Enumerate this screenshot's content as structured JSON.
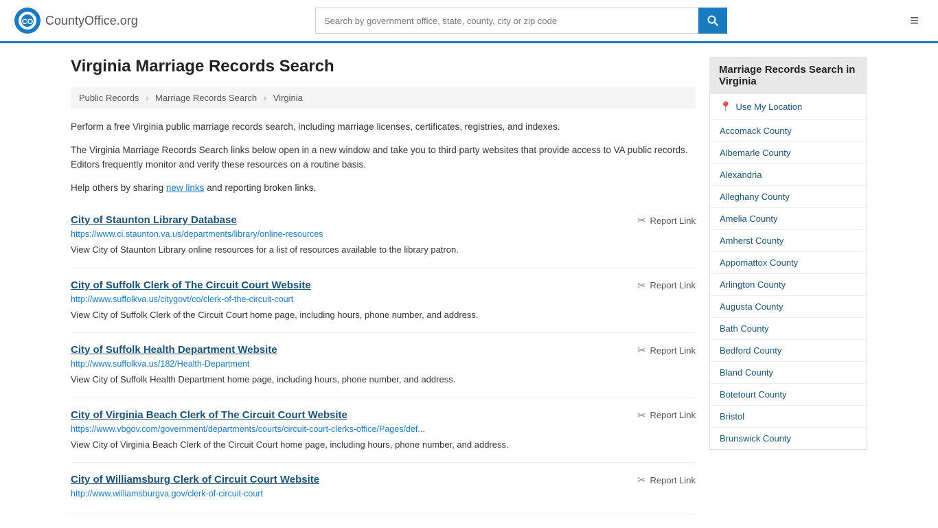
{
  "header": {
    "logo_text": "CountyOffice",
    "logo_suffix": ".org",
    "search_placeholder": "Search by government office, state, county, city or zip code",
    "menu_icon": "≡"
  },
  "page": {
    "title": "Virginia Marriage Records Search",
    "breadcrumb": {
      "items": [
        "Public Records",
        "Marriage Records Search",
        "Virginia"
      ]
    },
    "intro": [
      "Perform a free Virginia public marriage records search, including marriage licenses, certificates, registries, and indexes.",
      "The Virginia Marriage Records Search links below open in a new window and take you to third party websites that provide access to VA public records. Editors frequently monitor and verify these resources on a routine basis.",
      "Help others by sharing new links and reporting broken links."
    ],
    "results": [
      {
        "title": "City of Staunton Library Database",
        "url": "https://www.ci.staunton.va.us/departments/library/online-resources",
        "desc": "View City of Staunton Library online resources for a list of resources available to the library patron."
      },
      {
        "title": "City of Suffolk Clerk of The Circuit Court Website",
        "url": "http://www.suffolkva.us/citygovt/co/clerk-of-the-circuit-court",
        "desc": "View City of Suffolk Clerk of the Circuit Court home page, including hours, phone number, and address."
      },
      {
        "title": "City of Suffolk Health Department Website",
        "url": "http://www.suffolkva.us/182/Health-Department",
        "desc": "View City of Suffolk Health Department home page, including hours, phone number, and address."
      },
      {
        "title": "City of Virginia Beach Clerk of The Circuit Court Website",
        "url": "https://www.vbgov.com/government/departments/courts/circuit-court-clerks-office/Pages/def...",
        "desc": "View City of Virginia Beach Clerk of the Circuit Court home page, including hours, phone number, and address."
      },
      {
        "title": "City of Williamsburg Clerk of Circuit Court Website",
        "url": "http://www.williamsburgva.gov/clerk-of-circuit-court",
        "desc": ""
      }
    ],
    "report_link_label": "Report Link"
  },
  "sidebar": {
    "title": "Marriage Records Search in Virginia",
    "use_location_label": "Use My Location",
    "counties": [
      "Accomack County",
      "Albemarle County",
      "Alexandria",
      "Alleghany County",
      "Amelia County",
      "Amherst County",
      "Appomattox County",
      "Arlington County",
      "Augusta County",
      "Bath County",
      "Bedford County",
      "Bland County",
      "Botetourt County",
      "Bristol",
      "Brunswick County"
    ]
  }
}
